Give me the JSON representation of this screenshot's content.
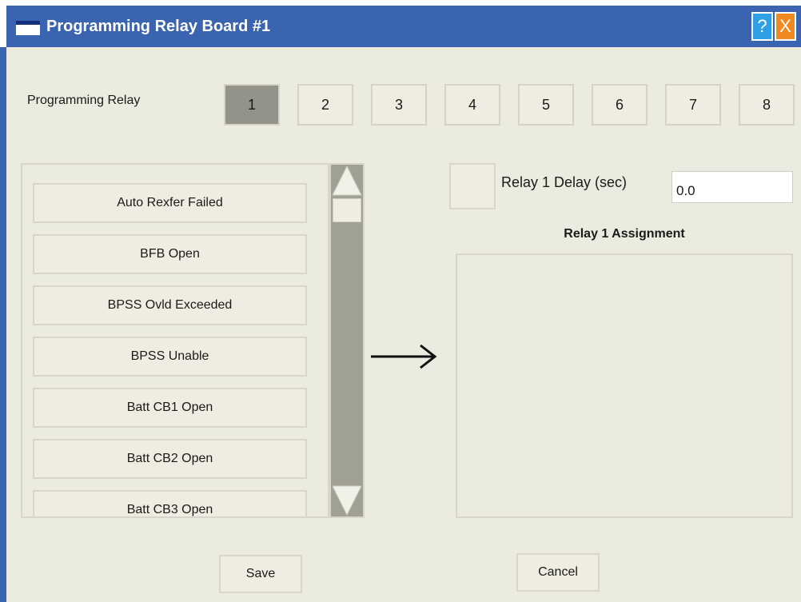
{
  "window": {
    "title": "Programming Relay Board #1",
    "help_label": "?",
    "close_label": "X"
  },
  "relay_selector": {
    "label": "Programming Relay",
    "relays": [
      "1",
      "2",
      "3",
      "4",
      "5",
      "6",
      "7",
      "8"
    ],
    "selected": "1"
  },
  "event_list": {
    "items": [
      "Auto Rexfer Failed",
      "BFB Open",
      "BPSS Ovld Exceeded",
      "BPSS Unable",
      "Batt CB1 Open",
      "Batt CB2 Open",
      "Batt CB3 Open"
    ]
  },
  "delay": {
    "label": "Relay 1 Delay (sec)",
    "value": "0.0",
    "enabled": false
  },
  "assignment": {
    "title": "Relay 1 Assignment",
    "items": []
  },
  "actions": {
    "save_label": "Save",
    "cancel_label": "Cancel"
  },
  "icons": {
    "transfer": "right-arrow-icon",
    "scroll_up": "triangle-up-icon",
    "scroll_down": "triangle-down-icon",
    "window": "window-icon"
  },
  "colors": {
    "titlebar": "#3a63b0",
    "panel_bg": "#ecebdf",
    "selected_relay": "#939389",
    "help_button": "#2f9fe6",
    "close_button": "#f08a1e"
  }
}
